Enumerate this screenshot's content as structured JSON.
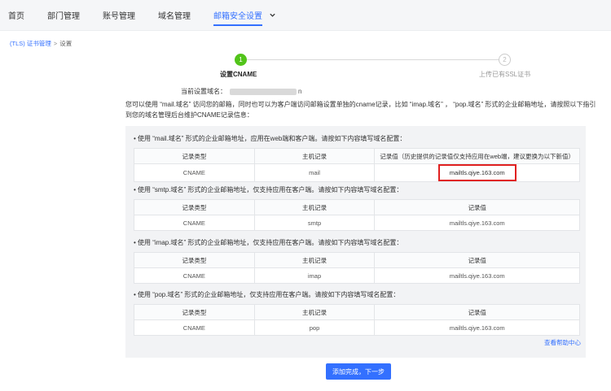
{
  "nav": {
    "items": [
      {
        "label": "首页"
      },
      {
        "label": "部门管理"
      },
      {
        "label": "账号管理"
      },
      {
        "label": "域名管理"
      },
      {
        "label": "邮箱安全设置"
      }
    ],
    "more_icon": "chevron-down-icon",
    "accent": "#3370ff"
  },
  "breadcrumb": {
    "link": "(TLS) 证书管理",
    "sep": ">",
    "current": "设置"
  },
  "steps": {
    "step1": {
      "num": "1",
      "label": "设置CNAME",
      "done_color": "#52c41a"
    },
    "step2": {
      "num": "2",
      "label": "上传已有SSL证书"
    }
  },
  "domain": {
    "label": "当前设置域名：",
    "visible_tail": "n"
  },
  "intro": "您可以使用 “mail.域名” 访问您的邮箱，同时也可以为客户端访问邮箱设置单独的cname记录，比如 “imap.域名” ， “pop.域名” 形式的企业邮箱地址，请按照以下指引到您的域名管理后台维护CNAME记录信息：",
  "sections": [
    {
      "title": "• 使用 “mail.域名” 形式的企业邮箱地址，应用在web端和客户端。请按如下内容填写域名配置：",
      "headers": [
        "记录类型",
        "主机记录",
        "记录值（历史提供的记录值仅支持应用在web端，建议更换为以下新值）"
      ],
      "row": [
        "CNAME",
        "mail",
        "mailtls.qiye.163.com"
      ]
    },
    {
      "title": "• 使用 “smtp.域名” 形式的企业邮箱地址，仅支持应用在客户端。请按如下内容填写域名配置：",
      "headers": [
        "记录类型",
        "主机记录",
        "记录值"
      ],
      "row": [
        "CNAME",
        "smtp",
        "mailtls.qiye.163.com"
      ]
    },
    {
      "title": "• 使用 “imap.域名” 形式的企业邮箱地址，仅支持应用在客户端。请按如下内容填写域名配置：",
      "headers": [
        "记录类型",
        "主机记录",
        "记录值"
      ],
      "row": [
        "CNAME",
        "imap",
        "mailtls.qiye.163.com"
      ]
    },
    {
      "title": "• 使用 “pop.域名” 形式的企业邮箱地址，仅支持应用在客户端。请按如下内容填写域名配置：",
      "headers": [
        "记录类型",
        "主机记录",
        "记录值"
      ],
      "row": [
        "CNAME",
        "pop",
        "mailtls.qiye.163.com"
      ]
    }
  ],
  "help_link": "查看帮助中心",
  "primary_button": "添加完成，下一步",
  "highlight_color": "#e02020"
}
